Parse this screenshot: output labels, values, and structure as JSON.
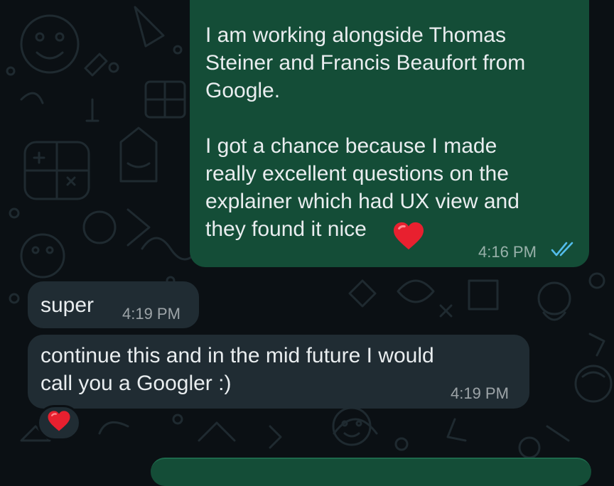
{
  "conversation": {
    "messages": [
      {
        "direction": "outgoing",
        "text": "I am working alongside Thomas\nSteiner and Francis Beaufort from\nGoogle.\n\nI got a chance because I made\nreally excellent questions on the\nexplainer which had UX view and\nthey found it nice",
        "emoji": "red-heart",
        "time": "4:16 PM",
        "status": "read"
      },
      {
        "direction": "incoming",
        "text": "super",
        "time": "4:19 PM"
      },
      {
        "direction": "incoming",
        "text": "continue this and in the mid future I would\ncall you a Googler :)",
        "time": "4:19 PM",
        "reaction": "red-heart"
      }
    ]
  },
  "colors": {
    "background": "#0b1014",
    "outgoing_bubble": "#144d37",
    "incoming_bubble": "#202c33",
    "read_ticks": "#53bdeb",
    "heart": "#e8202f"
  }
}
